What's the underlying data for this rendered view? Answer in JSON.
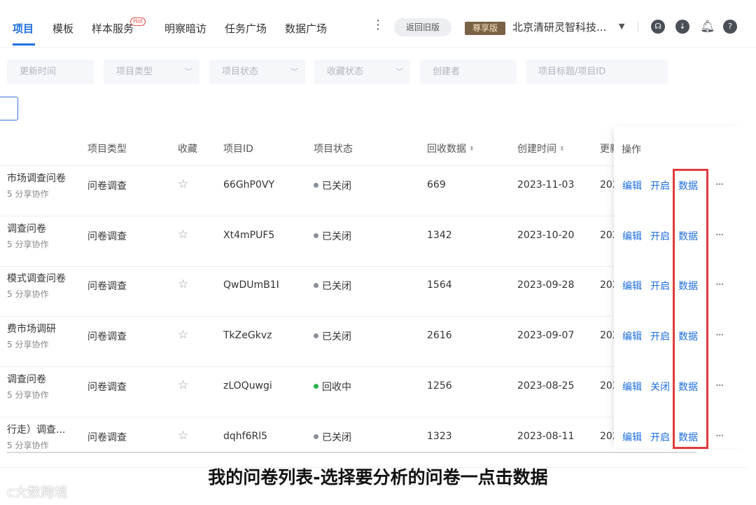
{
  "nav": {
    "items": [
      "项目",
      "模板",
      "样本服务",
      "明察暗访",
      "任务广场",
      "数据广场"
    ],
    "hot_badge": "Hot",
    "old_version_button": "返回旧版",
    "vip_badge": "尊享版",
    "company": "北京清研灵智科技...",
    "accent": "#1f6fe0"
  },
  "filters": {
    "update_time": "更新时间",
    "project_type": "项目类型",
    "project_status": "项目状态",
    "collect_status": "收藏状态",
    "creator": "创建者",
    "title_search": "项目标题/项目ID"
  },
  "table": {
    "headers": {
      "type": "项目类型",
      "collect": "收藏",
      "id": "项目ID",
      "status": "项目状态",
      "count": "回收数据",
      "created": "创建时间",
      "updated": "更新",
      "actions": "操作"
    },
    "rows": [
      {
        "title": "市场调查问卷",
        "sub": "5 分享协作",
        "type": "问卷调查",
        "id": "66GhP0VY",
        "status": "已关闭",
        "status_color": "#8a8f98",
        "count": "669",
        "created": "2023-11-03",
        "updated": "202",
        "edit": "编辑",
        "toggle": "开启",
        "data": "数据"
      },
      {
        "title": "调查问卷",
        "sub": "5 分享协作",
        "type": "问卷调查",
        "id": "Xt4mPUF5",
        "status": "已关闭",
        "status_color": "#8a8f98",
        "count": "1342",
        "created": "2023-10-20",
        "updated": "202",
        "edit": "编辑",
        "toggle": "开启",
        "data": "数据"
      },
      {
        "title": "模式调查问卷",
        "sub": "5 分享协作",
        "type": "问卷调查",
        "id": "QwDUmB1I",
        "status": "已关闭",
        "status_color": "#8a8f98",
        "count": "1564",
        "created": "2023-09-28",
        "updated": "202",
        "edit": "编辑",
        "toggle": "开启",
        "data": "数据"
      },
      {
        "title": "费市场调研",
        "sub": "5 分享协作",
        "type": "问卷调查",
        "id": "TkZeGkvz",
        "status": "已关闭",
        "status_color": "#8a8f98",
        "count": "2616",
        "created": "2023-09-07",
        "updated": "202",
        "edit": "编辑",
        "toggle": "开启",
        "data": "数据"
      },
      {
        "title": "调查问卷",
        "sub": "5 分享协作",
        "type": "问卷调查",
        "id": "zLOQuwgi",
        "status": "回收中",
        "status_color": "#2bb24c",
        "count": "1256",
        "created": "2023-08-25",
        "updated": "202",
        "edit": "编辑",
        "toggle": "关闭",
        "data": "数据"
      },
      {
        "title": "行走）调查...",
        "sub": "5 分享协作",
        "type": "问卷调查",
        "id": "dqhf6Rl5",
        "status": "已关闭",
        "status_color": "#8a8f98",
        "count": "1323",
        "created": "2023-08-11",
        "updated": "202",
        "edit": "编辑",
        "toggle": "开启",
        "data": "数据"
      }
    ]
  },
  "caption": "我的问卷列表-选择要分析的问卷一点击数据",
  "watermark": "大数跨境",
  "highlight_color": "#e03c3c"
}
